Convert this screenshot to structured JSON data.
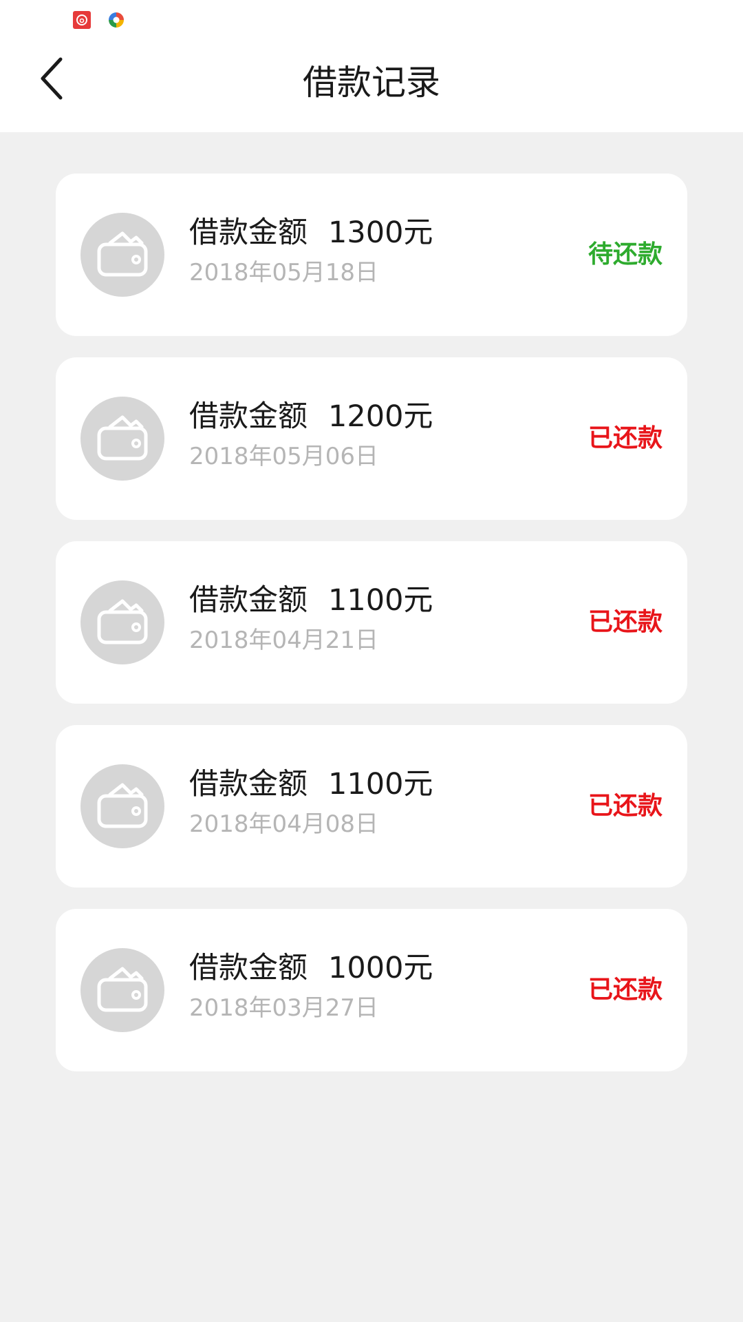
{
  "header": {
    "title": "借款记录",
    "back_icon": "chevron-left-icon"
  },
  "status_bar": {
    "icons": [
      "netease-music-icon",
      "browser-icon"
    ]
  },
  "records": [
    {
      "label": "借款金额",
      "amount": "1300元",
      "date": "2018年05月18日",
      "status": "待还款",
      "status_color": "#2eab2e"
    },
    {
      "label": "借款金额",
      "amount": "1200元",
      "date": "2018年05月06日",
      "status": "已还款",
      "status_color": "#e8151a"
    },
    {
      "label": "借款金额",
      "amount": "1100元",
      "date": "2018年04月21日",
      "status": "已还款",
      "status_color": "#e8151a"
    },
    {
      "label": "借款金额",
      "amount": "1100元",
      "date": "2018年04月08日",
      "status": "已还款",
      "status_color": "#e8151a"
    },
    {
      "label": "借款金额",
      "amount": "1000元",
      "date": "2018年03月27日",
      "status": "已还款",
      "status_color": "#e8151a"
    }
  ],
  "colors": {
    "background": "#f0f0f0",
    "card": "#ffffff",
    "avatar_bg": "#d6d6d6",
    "date_text": "#b5b5b5",
    "pending": "#2eab2e",
    "repaid": "#e8151a"
  }
}
